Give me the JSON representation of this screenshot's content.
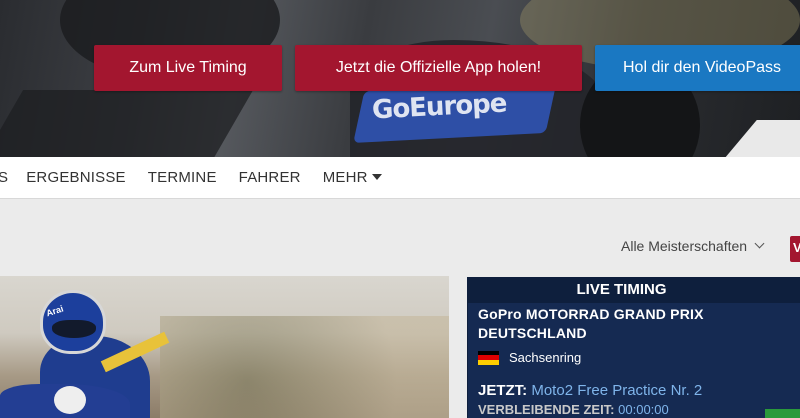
{
  "hero": {
    "fairing_text": "GoEurope",
    "buttons": {
      "live_timing": "Zum Live Timing",
      "app": "Jetzt die Offizielle App holen!",
      "videopass": "Hol dir den VideoPass"
    }
  },
  "nav": {
    "items": [
      "S",
      "ERGEBNISSE",
      "TERMINE",
      "FAHRER",
      "MEHR"
    ]
  },
  "filter": {
    "championship_select": "Alle Meisterschaften",
    "red_tab_label": "V"
  },
  "news": {
    "helmet_text": "Arai"
  },
  "live_timing": {
    "header": "LIVE TIMING",
    "event_title": "GoPro MOTORRAD GRAND PRIX DEUTSCHLAND",
    "venue": "Sachsenring",
    "now_label": "JETZT:",
    "session": "Moto2 Free Practice Nr. 2",
    "remaining_label": "VERBLEIBENDE ZEIT:",
    "remaining_time": "00:00:00"
  },
  "colors": {
    "brand_red": "#a3162f",
    "video_blue": "#1a78c2",
    "lt_navy": "#0e1f3d",
    "lt_panel": "#152a52"
  }
}
